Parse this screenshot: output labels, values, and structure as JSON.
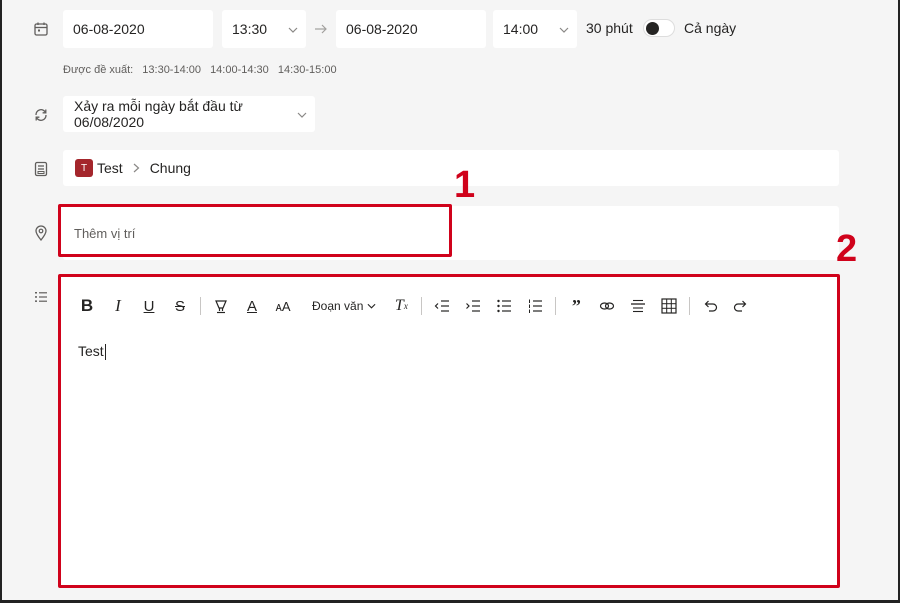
{
  "schedule": {
    "start_date": "06-08-2020",
    "start_time": "13:30",
    "end_date": "06-08-2020",
    "end_time": "14:00",
    "duration": "30 phút",
    "all_day_label": "Cả ngày",
    "suggest_label": "Được đề xuất:",
    "suggestions": [
      "13:30-14:00",
      "14:00-14:30",
      "14:30-15:00"
    ]
  },
  "recurrence": {
    "value": "Xảy ra mỗi ngày bắt đầu từ 06/08/2020"
  },
  "channel": {
    "avatar_letter": "T",
    "team": "Test",
    "separator": ">",
    "name": "Chung"
  },
  "location": {
    "placeholder": "Thêm vị trí"
  },
  "editor": {
    "paragraph_label": "Đoạn văn",
    "content": "Test"
  },
  "annotations": {
    "callout_1": "1",
    "callout_2": "2",
    "highlight_color": "#d0021b"
  },
  "icons": {
    "calendar": "calendar-icon",
    "repeat": "repeat-icon",
    "channel": "channel-icon",
    "location": "location-pin-icon",
    "details": "details-list-icon"
  }
}
